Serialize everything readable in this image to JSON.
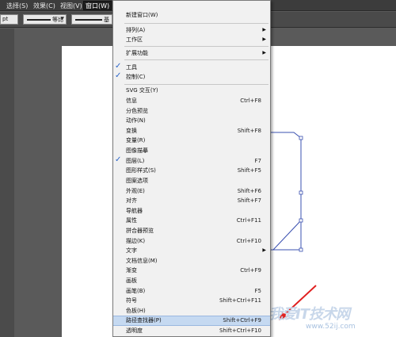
{
  "menubar": {
    "items": [
      "选择(S)",
      "效果(C)",
      "视图(V)",
      "窗口(W)"
    ]
  },
  "control": {
    "pt": "pt",
    "stroke1": "等比",
    "stroke2": "基"
  },
  "menu": {
    "items": [
      {
        "label": "新建窗口(W)",
        "shortcut": "",
        "submenu": false,
        "checked": false
      },
      {
        "label": "排列(A)",
        "shortcut": "",
        "submenu": true,
        "checked": false
      },
      {
        "label": "工作区",
        "shortcut": "",
        "submenu": true,
        "checked": false
      },
      {
        "label": "扩展功能",
        "shortcut": "",
        "submenu": true,
        "checked": false
      },
      {
        "label": "工具",
        "shortcut": "",
        "submenu": false,
        "checked": true
      },
      {
        "label": "控制(C)",
        "shortcut": "",
        "submenu": false,
        "checked": true
      },
      {
        "label": "SVG 交互(Y)",
        "shortcut": "",
        "submenu": false,
        "checked": false
      },
      {
        "label": "信息",
        "shortcut": "Ctrl+F8",
        "submenu": false,
        "checked": false
      },
      {
        "label": "分色预览",
        "shortcut": "",
        "submenu": false,
        "checked": false
      },
      {
        "label": "动作(N)",
        "shortcut": "",
        "submenu": false,
        "checked": false
      },
      {
        "label": "变换",
        "shortcut": "Shift+F8",
        "submenu": false,
        "checked": false
      },
      {
        "label": "变量(R)",
        "shortcut": "",
        "submenu": false,
        "checked": false
      },
      {
        "label": "图像描摹",
        "shortcut": "",
        "submenu": false,
        "checked": false
      },
      {
        "label": "图层(L)",
        "shortcut": "F7",
        "submenu": false,
        "checked": true
      },
      {
        "label": "图形样式(S)",
        "shortcut": "Shift+F5",
        "submenu": false,
        "checked": false
      },
      {
        "label": "图案选项",
        "shortcut": "",
        "submenu": false,
        "checked": false
      },
      {
        "label": "外观(E)",
        "shortcut": "Shift+F6",
        "submenu": false,
        "checked": false
      },
      {
        "label": "对齐",
        "shortcut": "Shift+F7",
        "submenu": false,
        "checked": false
      },
      {
        "label": "导航器",
        "shortcut": "",
        "submenu": false,
        "checked": false
      },
      {
        "label": "属性",
        "shortcut": "Ctrl+F11",
        "submenu": false,
        "checked": false
      },
      {
        "label": "拼合器预览",
        "shortcut": "",
        "submenu": false,
        "checked": false
      },
      {
        "label": "描边(K)",
        "shortcut": "Ctrl+F10",
        "submenu": false,
        "checked": false
      },
      {
        "label": "文字",
        "shortcut": "",
        "submenu": true,
        "checked": false
      },
      {
        "label": "文档信息(M)",
        "shortcut": "",
        "submenu": false,
        "checked": false
      },
      {
        "label": "渐变",
        "shortcut": "Ctrl+F9",
        "submenu": false,
        "checked": false
      },
      {
        "label": "画板",
        "shortcut": "",
        "submenu": false,
        "checked": false
      },
      {
        "label": "画笔(B)",
        "shortcut": "F5",
        "submenu": false,
        "checked": false
      },
      {
        "label": "符号",
        "shortcut": "Shift+Ctrl+F11",
        "submenu": false,
        "checked": false
      },
      {
        "label": "色板(H)",
        "shortcut": "",
        "submenu": false,
        "checked": false
      },
      {
        "label": "路径查找器(P)",
        "shortcut": "Shift+Ctrl+F9",
        "submenu": false,
        "checked": false,
        "highlighted": true
      },
      {
        "label": "透明度",
        "shortcut": "Shift+Ctrl+F10",
        "submenu": false,
        "checked": false
      }
    ]
  },
  "watermark": {
    "title": "我爱IT技术网",
    "url": "www.52ij.com"
  },
  "colors": {
    "menu_bg": "#f1f1f1",
    "highlight": "#c5d9f1",
    "check": "#2a64c8",
    "shape_stroke": "#3a50b0",
    "arrow": "#e02020"
  }
}
